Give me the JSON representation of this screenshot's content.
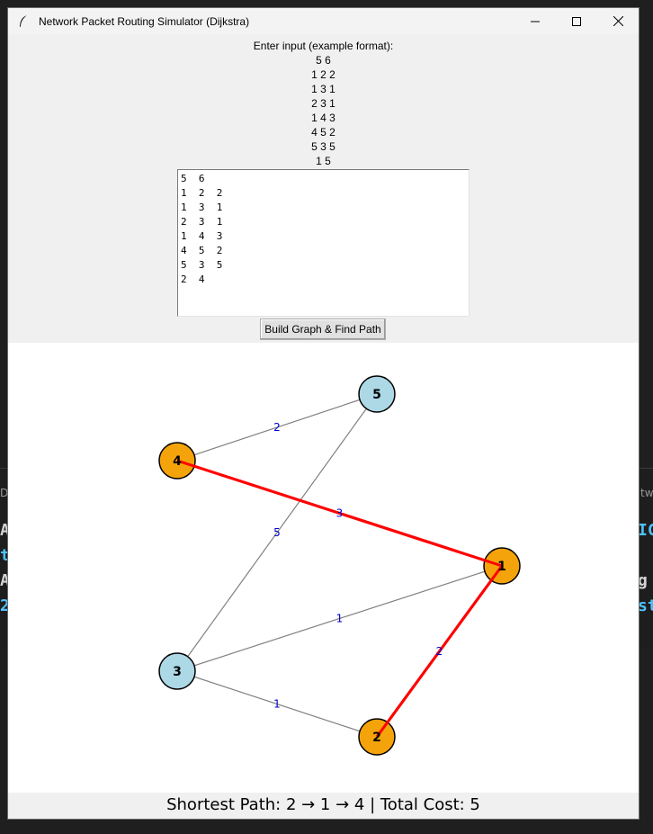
{
  "window": {
    "title": "Network Packet Routing Simulator (Dijkstra)"
  },
  "input_panel": {
    "prompt": "Enter input (example format):",
    "example_lines": [
      "5 6",
      "1 2 2",
      "1 3 1",
      "2 3 1",
      "1 4 3",
      "4 5 2",
      "5 3 5",
      "1 5"
    ],
    "textarea_value": "5  6\n1  2  2\n1  3  1\n2  3  1\n1  4  3\n4  5  2\n5  3  5\n2  4",
    "build_button_label": "Build Graph & Find Path"
  },
  "graph": {
    "nodes": [
      {
        "id": "1",
        "on_path": true
      },
      {
        "id": "2",
        "on_path": true
      },
      {
        "id": "3",
        "on_path": false
      },
      {
        "id": "4",
        "on_path": true
      },
      {
        "id": "5",
        "on_path": false
      }
    ],
    "edges": [
      {
        "from": "1",
        "to": "2",
        "weight": "2",
        "on_path": true
      },
      {
        "from": "1",
        "to": "3",
        "weight": "1",
        "on_path": false
      },
      {
        "from": "2",
        "to": "3",
        "weight": "1",
        "on_path": false
      },
      {
        "from": "1",
        "to": "4",
        "weight": "3",
        "on_path": true
      },
      {
        "from": "4",
        "to": "5",
        "weight": "2",
        "on_path": false
      },
      {
        "from": "5",
        "to": "3",
        "weight": "5",
        "on_path": false
      }
    ],
    "colors": {
      "path_node": "#f5a30a",
      "normal_node": "#add8e6",
      "path_edge": "#ff0000",
      "normal_edge": "#808080",
      "weight_label": "#0000cc"
    }
  },
  "result_text": "Shortest Path: 2 → 1 → 4 | Total Cost: 5",
  "background": {
    "left_chars": [
      "A",
      "t",
      "A",
      "2"
    ],
    "right_chars": [
      "IC",
      "",
      "g",
      "st"
    ],
    "left_small": "D",
    "right_small": "tw"
  }
}
